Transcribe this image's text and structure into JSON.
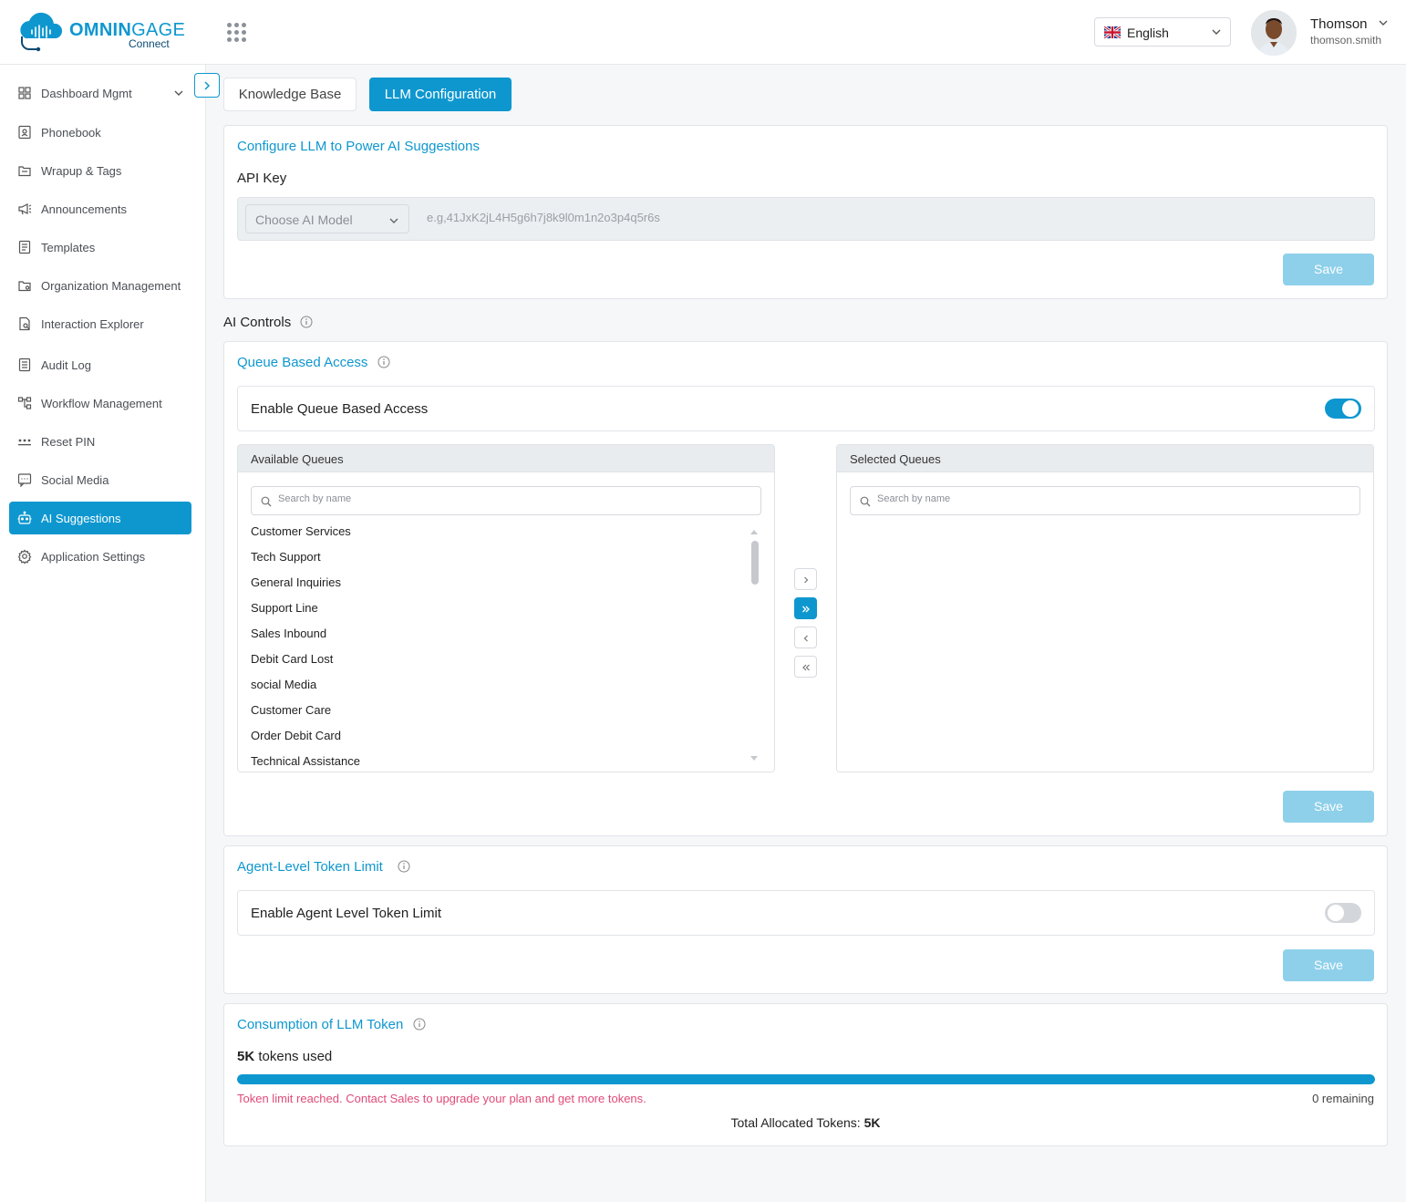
{
  "header": {
    "brand_bold": "OMNIN",
    "brand_mid": "GAGE",
    "brand_sub": "Connect",
    "language": "English",
    "user_name": "Thomson",
    "user_handle": "thomson.smith"
  },
  "sidebar": {
    "items": [
      {
        "label": "Dashboard Mgmt",
        "icon": "dashboard-grid-icon",
        "active": false
      },
      {
        "label": "Phonebook",
        "icon": "phonebook-icon",
        "active": false
      },
      {
        "label": "Wrapup & Tags",
        "icon": "folder-icon",
        "active": false
      },
      {
        "label": "Announcements",
        "icon": "megaphone-icon",
        "active": false
      },
      {
        "label": "Templates",
        "icon": "document-icon",
        "active": false
      },
      {
        "label": "Organization Management",
        "icon": "org-folder-icon",
        "active": false
      },
      {
        "label": "Interaction Explorer",
        "icon": "file-search-icon",
        "active": false
      },
      {
        "label": "Audit Log",
        "icon": "list-icon",
        "active": false
      },
      {
        "label": "Workflow Management",
        "icon": "workflow-icon",
        "active": false
      },
      {
        "label": "Reset PIN",
        "icon": "pin-dots-icon",
        "active": false
      },
      {
        "label": "Social Media",
        "icon": "chat-icon",
        "active": false
      },
      {
        "label": "AI Suggestions",
        "icon": "bot-icon",
        "active": true
      },
      {
        "label": "Application Settings",
        "icon": "gear-icon",
        "active": false
      }
    ]
  },
  "tabs": {
    "knowledge_base": "Knowledge Base",
    "llm_configuration": "LLM Configuration"
  },
  "llm_config": {
    "title": "Configure LLM to Power AI Suggestions",
    "api_key_label": "API Key",
    "model_placeholder": "Choose AI Model",
    "api_key_placeholder": "e.g,41JxK2jL4H5g6h7j8k9l0m1n2o3p4q5r6s",
    "save_label": "Save"
  },
  "ai_controls": {
    "label": "AI Controls"
  },
  "queue_access": {
    "title": "Queue Based Access",
    "toggle_label": "Enable Queue Based Access",
    "enabled": true,
    "available_title": "Available Queues",
    "selected_title": "Selected Queues",
    "search_placeholder": "Search by name",
    "available_queues": [
      "Customer Services",
      "Tech Support",
      "General Inquiries",
      "Support Line",
      "Sales Inbound",
      "Debit Card Lost",
      "social Media",
      "Customer Care",
      "Order Debit Card",
      "Technical Assistance"
    ],
    "selected_queues": [],
    "save_label": "Save"
  },
  "token_limit": {
    "title": "Agent-Level Token Limit",
    "toggle_label": "Enable Agent Level Token Limit",
    "enabled": false,
    "save_label": "Save"
  },
  "consumption": {
    "title": "Consumption of LLM Token",
    "used_value": "5K",
    "used_suffix": "tokens used",
    "used_fraction": 1.0,
    "limit_message": "Token limit reached. Contact Sales to upgrade your plan and get more tokens.",
    "remaining": "0 remaining",
    "total_label": "Total Allocated Tokens:",
    "total_value": "5K"
  },
  "colors": {
    "accent": "#0e97cf",
    "save_disabled": "#8ed0ea",
    "warning": "#e04a7a"
  }
}
